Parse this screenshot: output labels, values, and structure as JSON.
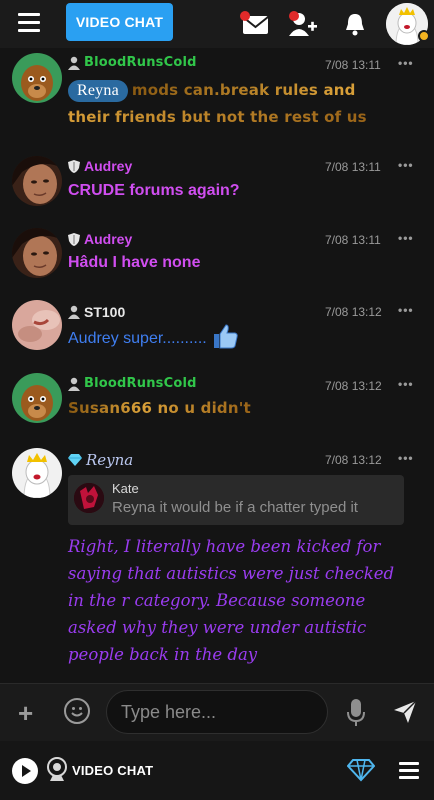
{
  "topbar": {
    "video_chat_label": "VIDEO CHAT",
    "icons": [
      "menu-icon",
      "mail-icon",
      "add-friend-icon",
      "bell-icon",
      "avatar"
    ]
  },
  "messages": [
    {
      "user": "BloodRunsCold",
      "time": "7/08 13:11",
      "more": "•••",
      "mention": "Reyna",
      "text": "mods can.break rules and their friends but not the rest of us"
    },
    {
      "user": "Audrey",
      "time": "7/08 13:11",
      "more": "•••",
      "text": "CRUDE forums again?"
    },
    {
      "user": "Audrey",
      "time": "7/08 13:11",
      "more": "•••",
      "text": "Hâdu I have none"
    },
    {
      "user": "ST100",
      "time": "7/08 13:12",
      "more": "•••",
      "text": "Audrey super..........",
      "emoji": "👍"
    },
    {
      "user": "BloodRunsCold",
      "time": "7/08 13:12",
      "more": "•••",
      "text": "Susan666 no u didn't"
    },
    {
      "user": "Reyna",
      "time": "7/08 13:12",
      "more": "•••",
      "quote": {
        "user": "Kate",
        "text": "Reyna it would be if a chatter typed it"
      },
      "text": "Right, I literally have been kicked for saying that autistics were just checked in the r category. Because someone asked why they were under autistic people back in the day"
    }
  ],
  "input": {
    "plus": "+",
    "placeholder": "Type here..."
  },
  "bottombar": {
    "video_chat_label": "VIDEO CHAT"
  },
  "colors": {
    "accent": "#2aa0f2",
    "purple_user": "#d04ef0",
    "green_user": "#31c64a",
    "blue_text": "#3f7ef0",
    "reyna_text": "#9a3cf0"
  }
}
